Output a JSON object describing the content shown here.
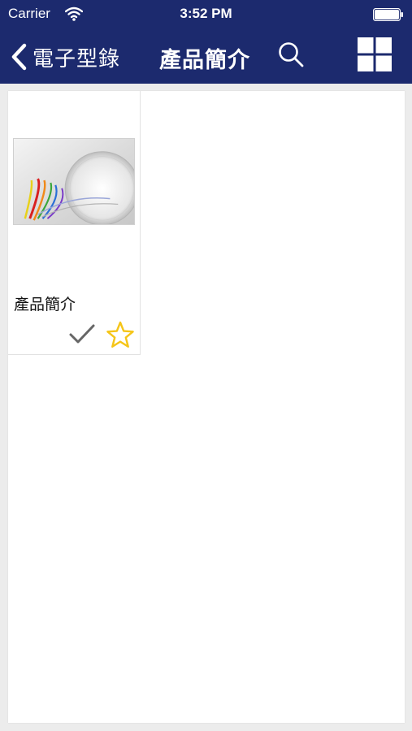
{
  "status_bar": {
    "carrier": "Carrier",
    "time": "3:52 PM"
  },
  "nav": {
    "back_label": "電子型錄",
    "title": "產品簡介",
    "search_icon": "search-icon",
    "grid_icon": "grid-view-icon"
  },
  "catalog": {
    "items": [
      {
        "title": "產品簡介",
        "thumbnail": "product-brochure-cover",
        "selected_icon": "checkmark-icon",
        "favorite_icon": "star-outline-icon"
      }
    ]
  },
  "colors": {
    "nav_background": "#1c2a6e",
    "content_background": "#ffffff",
    "page_background": "#ececec",
    "star": "#f5c518",
    "check": "#666666"
  }
}
